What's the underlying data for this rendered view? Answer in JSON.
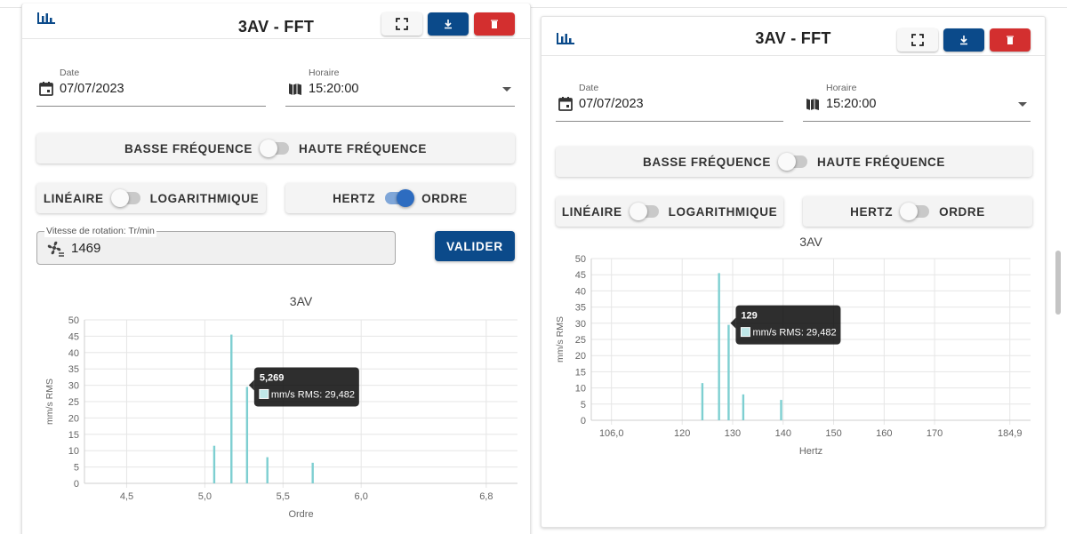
{
  "colors": {
    "accent_blue": "#0b4a8a",
    "danger_red": "#d32f2f",
    "bar": "#7ecfd1",
    "switch_on": "#2d6cc0"
  },
  "panels": [
    {
      "title": "3AV - FFT",
      "icons": {
        "chart": "bar-chart-icon",
        "fullscreen": "fullscreen-icon",
        "download": "download-icon",
        "delete": "trash-icon"
      },
      "date": {
        "label": "Date",
        "value": "07/07/2023",
        "icon": "calendar-icon"
      },
      "horaire": {
        "label": "Horaire",
        "value": "15:20:00",
        "icon": "map-icon"
      },
      "freq_toggle": {
        "left": "BASSE FRÉQUENCE",
        "right": "HAUTE FRÉQUENCE",
        "on": false
      },
      "scale_toggle": {
        "left": "LINÉAIRE",
        "right": "LOGARITHMIQUE",
        "on": false
      },
      "unit_toggle": {
        "left": "HERTZ",
        "right": "ORDRE",
        "on": true
      },
      "speed": {
        "label": "Vitesse de rotation: Tr/min",
        "value": "1469",
        "icon": "fan-icon"
      },
      "validate_label": "VALIDER",
      "tooltip": {
        "title": "5,269",
        "label": "mm/s RMS: 29,482"
      }
    },
    {
      "title": "3AV - FFT",
      "icons": {
        "chart": "bar-chart-icon",
        "fullscreen": "fullscreen-icon",
        "download": "download-icon",
        "delete": "trash-icon"
      },
      "date": {
        "label": "Date",
        "value": "07/07/2023",
        "icon": "calendar-icon"
      },
      "horaire": {
        "label": "Horaire",
        "value": "15:20:00",
        "icon": "map-icon"
      },
      "freq_toggle": {
        "left": "BASSE FRÉQUENCE",
        "right": "HAUTE FRÉQUENCE",
        "on": false
      },
      "scale_toggle": {
        "left": "LINÉAIRE",
        "right": "LOGARITHMIQUE",
        "on": false
      },
      "unit_toggle": {
        "left": "HERTZ",
        "right": "ORDRE",
        "on": false
      },
      "tooltip": {
        "title": "129",
        "label": "mm/s RMS: 29,482"
      }
    }
  ],
  "chart_data": [
    {
      "type": "bar",
      "title": "3AV",
      "xlabel": "Ordre",
      "ylabel": "mm/s RMS",
      "xlim": [
        4.23,
        7.0
      ],
      "ylim": [
        0,
        50
      ],
      "yticks": [
        0,
        5,
        10,
        15,
        20,
        25,
        30,
        35,
        40,
        45,
        50
      ],
      "xticks": [
        {
          "v": 4.5,
          "label": "4,5"
        },
        {
          "v": 5.0,
          "label": "5,0"
        },
        {
          "v": 5.5,
          "label": "5,5"
        },
        {
          "v": 6.0,
          "label": "6,0"
        },
        {
          "v": 6.8,
          "label": "6,8"
        }
      ],
      "x": [
        5.06,
        5.17,
        5.27,
        5.4,
        5.69
      ],
      "values": [
        11.5,
        45.5,
        29.5,
        8.0,
        6.3
      ],
      "grid": true,
      "tooltip_index": 2
    },
    {
      "type": "bar",
      "title": "3AV",
      "xlabel": "Hertz",
      "ylabel": "mm/s RMS",
      "xlim": [
        102.0,
        189.0
      ],
      "ylim": [
        0,
        50
      ],
      "yticks": [
        0,
        5,
        10,
        15,
        20,
        25,
        30,
        35,
        40,
        45,
        50
      ],
      "xticks": [
        {
          "v": 106.0,
          "label": "106,0"
        },
        {
          "v": 120,
          "label": "120"
        },
        {
          "v": 130,
          "label": "130"
        },
        {
          "v": 140,
          "label": "140"
        },
        {
          "v": 150,
          "label": "150"
        },
        {
          "v": 160,
          "label": "160"
        },
        {
          "v": 170,
          "label": "170"
        },
        {
          "v": 184.9,
          "label": "184,9"
        }
      ],
      "x": [
        124.0,
        127.3,
        129.2,
        132.1,
        139.6
      ],
      "values": [
        11.5,
        45.5,
        29.5,
        8.0,
        6.3
      ],
      "grid": true,
      "tooltip_index": 2
    }
  ]
}
